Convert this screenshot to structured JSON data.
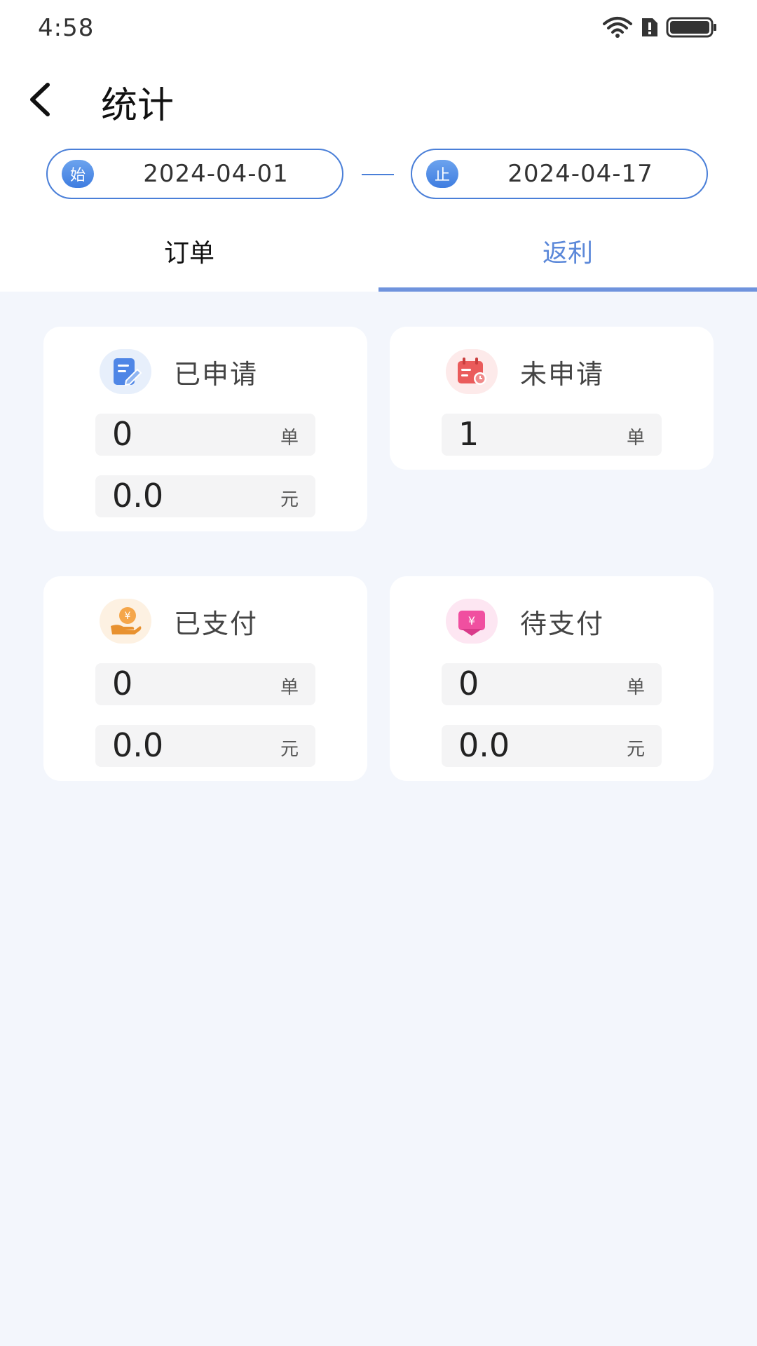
{
  "status_bar": {
    "time": "4:58"
  },
  "header": {
    "title": "统计"
  },
  "date_range": {
    "start_badge": "始",
    "start_date": "2024-04-01",
    "end_badge": "止",
    "end_date": "2024-04-17"
  },
  "tabs": [
    {
      "label": "订单",
      "active": false
    },
    {
      "label": "返利",
      "active": true
    }
  ],
  "colors": {
    "accent": "#4a7fd8",
    "active_tab": "#5b88d9",
    "background": "#f3f6fc"
  },
  "cards": {
    "applied": {
      "title": "已申请",
      "icon": "document-edit-icon",
      "orders": "0",
      "orders_unit": "单",
      "amount": "0.0",
      "amount_unit": "元"
    },
    "unapplied": {
      "title": "未申请",
      "icon": "calendar-clock-icon",
      "orders": "1",
      "orders_unit": "单"
    },
    "paid": {
      "title": "已支付",
      "icon": "hand-coin-icon",
      "orders": "0",
      "orders_unit": "单",
      "amount": "0.0",
      "amount_unit": "元"
    },
    "pending": {
      "title": "待支付",
      "icon": "wallet-yen-icon",
      "orders": "0",
      "orders_unit": "单",
      "amount": "0.0",
      "amount_unit": "元"
    }
  }
}
